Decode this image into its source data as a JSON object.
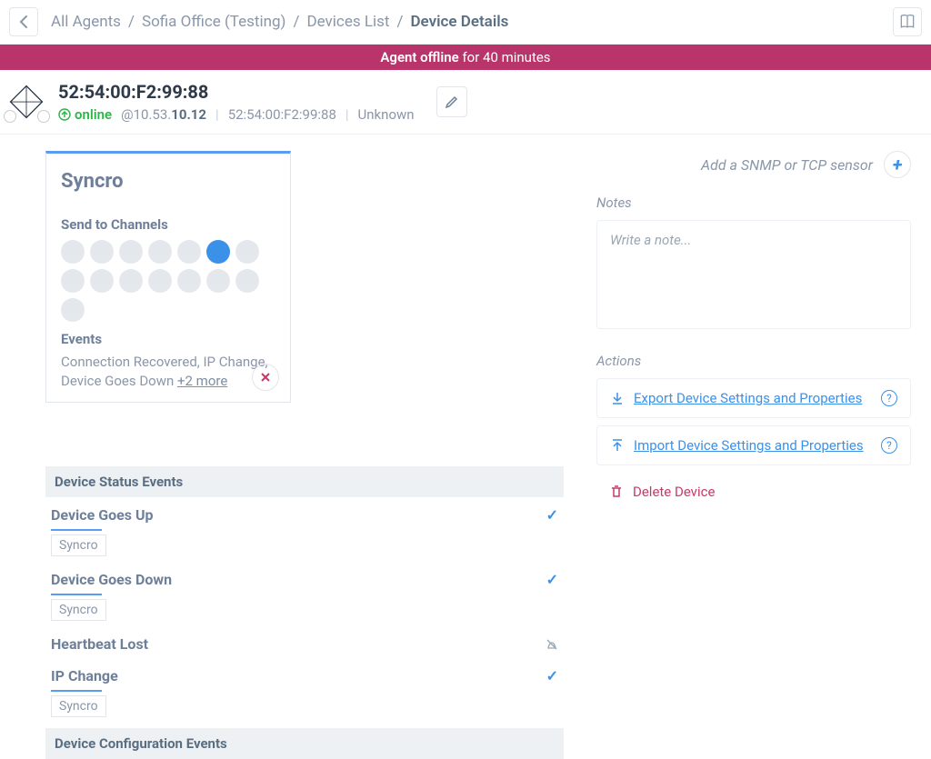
{
  "breadcrumb": {
    "items": [
      "All Agents",
      "Sofia Office (Testing)",
      "Devices List",
      "Device Details"
    ],
    "active_index": 3
  },
  "alert": {
    "label": "Agent offline",
    "duration": "for 40 minutes"
  },
  "device": {
    "mac": "52:54:00:F2:99:88",
    "status": "online",
    "ip_prefix": "@10.53.",
    "ip_bold": "10.12",
    "mac2": "52:54:00:F2:99:88",
    "vendor": "Unknown"
  },
  "syncro": {
    "title": "Syncro",
    "channels_label": "Send to Channels",
    "events_label": "Events",
    "events_text": "Connection Recovered, IP Change, Device Goes Down ",
    "more_link": "+2 more"
  },
  "event_sections": {
    "status_header": "Device Status Events",
    "config_header": "Device Configuration Events"
  },
  "events": [
    {
      "name": "Device Goes Up",
      "enabled": true,
      "tag": "Syncro"
    },
    {
      "name": "Device Goes Down",
      "enabled": true,
      "tag": "Syncro"
    },
    {
      "name": "Heartbeat Lost",
      "enabled": false,
      "tag": null
    },
    {
      "name": "IP Change",
      "enabled": true,
      "tag": "Syncro"
    }
  ],
  "sensor": {
    "add_label": "Add a SNMP or TCP sensor"
  },
  "notes": {
    "header": "Notes",
    "placeholder": "Write a note..."
  },
  "actions": {
    "header": "Actions",
    "export": "Export Device Settings and Properties",
    "import": "Import Device Settings and Properties",
    "delete": "Delete Device"
  }
}
